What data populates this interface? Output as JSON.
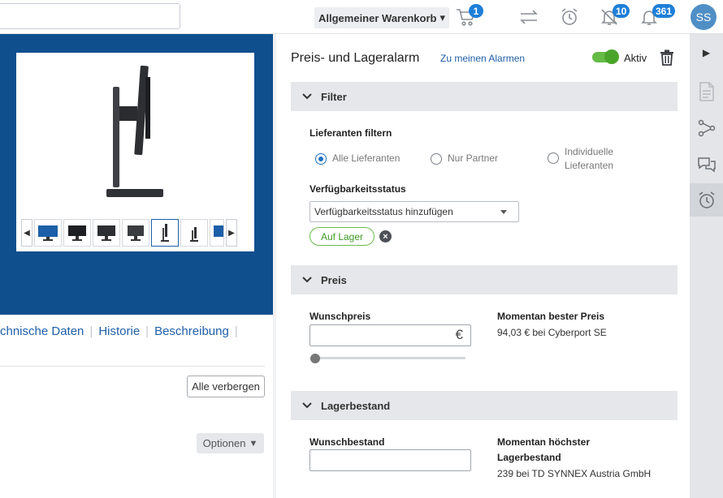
{
  "topbar": {
    "cart_selector": "Allgemeiner Warenkorb",
    "cart_caret": "▾",
    "cart_count": "1",
    "notifications_count": "10",
    "messages_count": "361",
    "avatar_initials": "SS"
  },
  "product": {
    "thumbnail_count": 7,
    "selected_thumbnail": 5,
    "prev_glyph": "◀",
    "next_glyph": "▶"
  },
  "tabs": {
    "items": [
      "chnische Daten",
      "Historie",
      "Beschreibung"
    ],
    "separator": "|"
  },
  "left_buttons": {
    "hide_all": "Alle verbergen",
    "options": "Optionen",
    "options_caret": "▼"
  },
  "alarm": {
    "title": "Preis- und Lageralarm",
    "my_alarms_link": "Zu meinen Alarmen",
    "active_label": "Aktiv",
    "active": true,
    "filter": {
      "header": "Filter",
      "supplier_label": "Lieferanten filtern",
      "options": [
        "Alle Lieferanten",
        "Nur Partner",
        "Individuelle Lieferanten"
      ],
      "selected_option": "Alle Lieferanten",
      "availability_label": "Verfügbarkeitsstatus",
      "availability_dropdown": "Verfügbarkeitsstatus hinzufügen",
      "chip": "Auf Lager",
      "chip_remove": "×"
    },
    "price": {
      "header": "Preis",
      "wish_label": "Wunschpreis",
      "wish_value": "",
      "currency_symbol": "€",
      "best_label": "Momentan bester Preis",
      "best_value": "94,03 € bei Cyberport SE",
      "slider_level": 0
    },
    "stock": {
      "header": "Lagerbestand",
      "wish_label": "Wunschbestand",
      "wish_value": "",
      "best_label_line1": "Momentan höchster",
      "best_label_line2": "Lagerbestand",
      "best_value": "239 bei TD SYNNEX Austria GmbH"
    }
  },
  "rail": {
    "collapse_glyph": "▶",
    "items": [
      "document-icon",
      "share-icon",
      "chat-icon",
      "alarm-clock-icon"
    ],
    "active_item": "alarm-clock-icon"
  },
  "colors": {
    "hero_blue": "#0f4f8e",
    "link_blue": "#1e5fa8",
    "badge_blue": "#1e7fd8",
    "toggle_green": "#4aa42a",
    "chip_green": "#3f9a24"
  }
}
